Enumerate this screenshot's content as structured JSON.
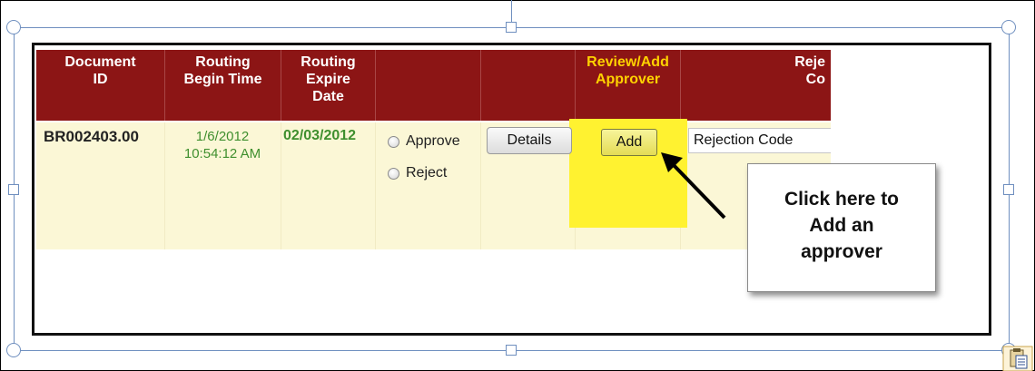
{
  "table": {
    "headers": {
      "document_id": "Document\nID",
      "routing_begin": "Routing\nBegin Time",
      "routing_expire": "Routing\nExpire\nDate",
      "blank1": "",
      "blank2": "",
      "review_add": "Review/Add\nApprover",
      "rejection": "Reje\nCo"
    },
    "row": {
      "document_id": "BR002403.00",
      "begin_time": "1/6/2012\n10:54:12 AM",
      "expire_date": "02/03/2012",
      "approve_label": "Approve",
      "reject_label": "Reject",
      "details_label": "Details",
      "add_label": "Add",
      "rejection_code": "Rejection Code"
    }
  },
  "callout": {
    "text": "Click here to\nAdd an\napprover"
  },
  "colors": {
    "header_bg": "#8c1515",
    "header_yellow": "#ffd200",
    "row_bg": "#fbf7d6",
    "highlight": "#fff230",
    "green_text": "#3f8f2e"
  },
  "icons": {
    "paste": "paste-options-icon",
    "arrow": "pointer-arrow"
  }
}
